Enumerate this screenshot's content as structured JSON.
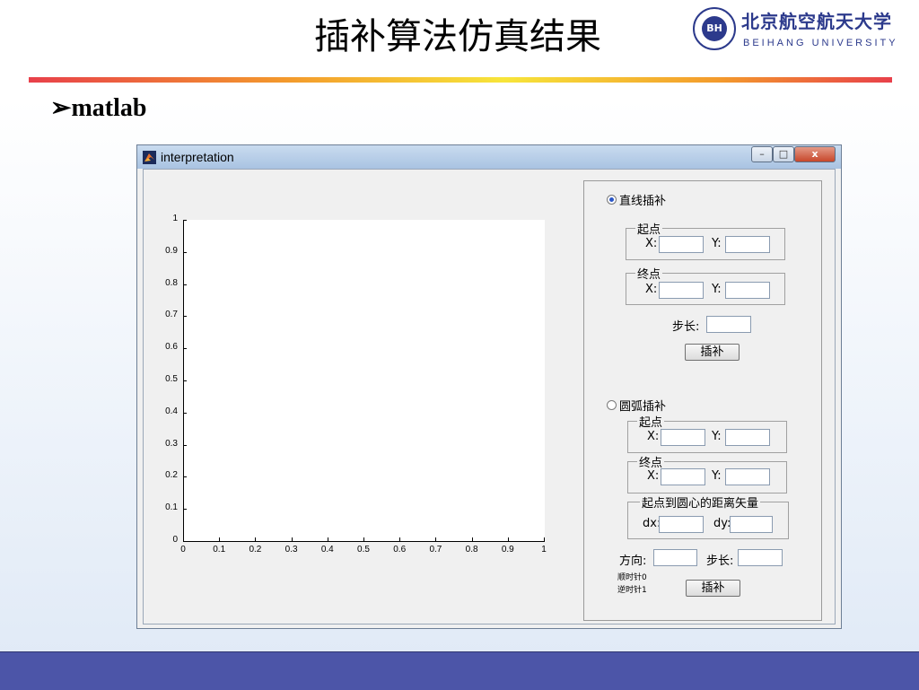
{
  "slide": {
    "title": "插补算法仿真结果",
    "bullet": "➢matlab",
    "logo": {
      "cn": "北京航空航天大学",
      "en": "BEIHANG UNIVERSITY",
      "seal_text": "BH"
    }
  },
  "window": {
    "title": "interpretation",
    "buttons": {
      "minimize": "–",
      "maximize": "□",
      "close": "x"
    }
  },
  "axes": {
    "yticks": [
      "0",
      "0.1",
      "0.2",
      "0.3",
      "0.4",
      "0.5",
      "0.6",
      "0.7",
      "0.8",
      "0.9",
      "1"
    ],
    "xticks": [
      "0",
      "0.1",
      "0.2",
      "0.3",
      "0.4",
      "0.5",
      "0.6",
      "0.7",
      "0.8",
      "0.9",
      "1"
    ]
  },
  "line": {
    "radio": "直线插补",
    "start": {
      "legend": "起点",
      "x_label": "X:",
      "y_label": "Y:",
      "x": "",
      "y": ""
    },
    "end": {
      "legend": "终点",
      "x_label": "X:",
      "y_label": "Y:",
      "x": "",
      "y": ""
    },
    "step_label": "步长:",
    "step": "",
    "button": "插补"
  },
  "arc": {
    "radio": "圆弧插补",
    "start": {
      "legend": "起点",
      "x_label": "X:",
      "y_label": "Y:",
      "x": "",
      "y": ""
    },
    "end": {
      "legend": "终点",
      "x_label": "X:",
      "y_label": "Y:",
      "x": "",
      "y": ""
    },
    "vector": {
      "legend": "起点到圆心的距离矢量",
      "dx_label": "dx:",
      "dy_label": "dy:",
      "dx": "",
      "dy": ""
    },
    "direction_label": "方向:",
    "direction": "",
    "step_label": "步长:",
    "step": "",
    "cw_hint": "顺时针0",
    "ccw_hint": "逆时针1",
    "button": "插补"
  },
  "colors": {
    "footer": "#4c55a8",
    "radio_selected": "#2a56c6"
  }
}
